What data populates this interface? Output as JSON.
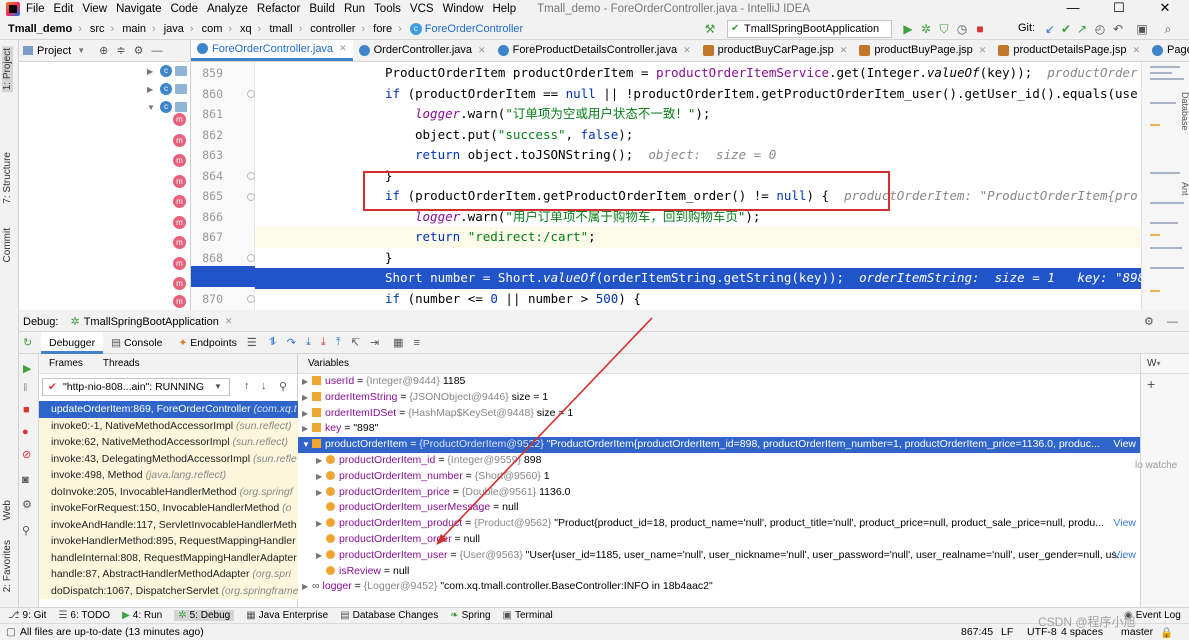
{
  "menu": [
    "File",
    "Edit",
    "View",
    "Navigate",
    "Code",
    "Analyze",
    "Refactor",
    "Build",
    "Run",
    "Tools",
    "VCS",
    "Window",
    "Help"
  ],
  "window_title": "Tmall_demo - ForeOrderController.java - IntelliJ IDEA",
  "breadcrumbs": [
    "Tmall_demo",
    "src",
    "main",
    "java",
    "com",
    "xq",
    "tmall",
    "controller",
    "fore",
    "ForeOrderController"
  ],
  "run_config": "TmallSpringBootApplication",
  "git_label": "Git:",
  "project_panel": {
    "title": "Project"
  },
  "left_strip": [
    "1: Project",
    "7: Structure",
    "Commit",
    "Web",
    "2: Favorites"
  ],
  "right_strip": [
    "Database",
    "Ant"
  ],
  "editor_tabs": [
    {
      "label": "ForeOrderController.java",
      "active": true
    },
    {
      "label": "OrderController.java",
      "active": false
    },
    {
      "label": "ForeProductDetailsController.java",
      "active": false
    },
    {
      "label": "productBuyCarPage.jsp",
      "active": false
    },
    {
      "label": "productBuyPage.jsp",
      "active": false
    },
    {
      "label": "productDetailsPage.jsp",
      "active": false
    },
    {
      "label": "PageUtil",
      "active": false
    }
  ],
  "line_numbers": [
    "859",
    "860",
    "861",
    "862",
    "863",
    "864",
    "865",
    "866",
    "867",
    "868",
    "869",
    "870"
  ],
  "code": {
    "l859a": "ProductOrderItem productOrderItem = ",
    "l859b": "productOrderItemService",
    "l859c": ".get(Integer.",
    "l859d": "valueOf",
    "l859e": "(key));  ",
    "l859h": "productOrder",
    "l860a": "if",
    "l860b": " (productOrderItem == ",
    "l860c": "null",
    "l860d": " || !productOrderItem.getProductOrderItem_user().getUser_id().equals(use",
    "l861a": "logger",
    "l861b": ".warn(",
    "l861c": "\"订单项为空或用户状态不一致！\"",
    "l861d": ");",
    "l862a": "object.put(",
    "l862b": "\"success\"",
    "l862c": ", ",
    "l862d": "false",
    "l862e": ");",
    "l863a": "return",
    "l863b": " object.toJSONString();  ",
    "l863h": "object:  size = 0",
    "l864": "}",
    "l865a": "if",
    "l865b": " (productOrderItem.getProductOrderItem_order() != ",
    "l865c": "null",
    "l865d": ") {  ",
    "l865h": "productOrderItem: \"ProductOrderItem{pro",
    "l866a": "logger",
    "l866b": ".warn(",
    "l866c": "\"用户订单项不属于购物车，回到购物车页\"",
    "l866d": ");",
    "l867a": "return",
    "l867c": "\"redirect:/cart\"",
    "l867d": ";",
    "l868": "}",
    "l869a": "Short number = Short.",
    "l869b": "valueOf",
    "l869c": "(orderItemString.getString(key));  ",
    "l869h": "orderItemString:  size = 1   key: \"898",
    "l870a": "if",
    "l870b": " (number <= ",
    "l870c": "0",
    "l870d": " || number > ",
    "l870e": "500",
    "l870f": ") {"
  },
  "debug": {
    "label": "Debug:",
    "session": "TmallSpringBootApplication",
    "tabs": [
      "Debugger",
      "Console",
      "Endpoints"
    ],
    "frames_tab": "Frames",
    "threads_tab": "Threads",
    "variables_tab": "Variables",
    "thread": "\"http-nio-808...ain\": RUNNING",
    "watches_label": "lo watche",
    "watches_menu": "W",
    "frames": [
      {
        "method": "updateOrderItem:869, ForeOrderController",
        "pkg": "(com.xq.t"
      },
      {
        "method": "invoke0:-1, NativeMethodAccessorImpl",
        "pkg": "(sun.reflect)"
      },
      {
        "method": "invoke:62, NativeMethodAccessorImpl",
        "pkg": "(sun.reflect)"
      },
      {
        "method": "invoke:43, DelegatingMethodAccessorImpl",
        "pkg": "(sun.refle"
      },
      {
        "method": "invoke:498, Method",
        "pkg": "(java.lang.reflect)"
      },
      {
        "method": "doInvoke:205, InvocableHandlerMethod",
        "pkg": "(org.springf"
      },
      {
        "method": "invokeForRequest:150, InvocableHandlerMethod",
        "pkg": "(o"
      },
      {
        "method": "invokeAndHandle:117, ServletInvocableHandlerMeth",
        "pkg": ""
      },
      {
        "method": "invokeHandlerMethod:895, RequestMappingHandler",
        "pkg": ""
      },
      {
        "method": "handleInternal:808, RequestMappingHandlerAdapter",
        "pkg": ""
      },
      {
        "method": "handle:87, AbstractHandlerMethodAdapter",
        "pkg": "(org.spri"
      },
      {
        "method": "doDispatch:1067, DispatcherServlet",
        "pkg": "(org.springframe"
      }
    ],
    "variables": [
      {
        "name": "userId",
        "type": "{Integer@9444}",
        "value": "1185"
      },
      {
        "name": "orderItemString",
        "type": "{JSONObject@9446}",
        "value": " size = 1"
      },
      {
        "name": "orderItemIDSet",
        "type": "{HashMap$KeySet@9448}",
        "value": " size = 1"
      },
      {
        "name": "key",
        "type": "",
        "value": "\"898\""
      },
      {
        "name": "productOrderItem",
        "type": "{ProductOrderItem@9522}",
        "value": "\"ProductOrderItem{productOrderItem_id=898, productOrderItem_number=1, productOrderItem_price=1136.0, produc...",
        "view": "View"
      },
      {
        "name": "productOrderItem_id",
        "type": "{Integer@9559}",
        "value": "898"
      },
      {
        "name": "productOrderItem_number",
        "type": "{Short@9560}",
        "value": "1"
      },
      {
        "name": "productOrderItem_price",
        "type": "{Double@9561}",
        "value": "1136.0"
      },
      {
        "name": "productOrderItem_userMessage",
        "type": "",
        "value": "null"
      },
      {
        "name": "productOrderItem_product",
        "type": "{Product@9562}",
        "value": "\"Product{product_id=18, product_name='null', product_title='null', product_price=null, product_sale_price=null, produ...",
        "view": "View"
      },
      {
        "name": "productOrderItem_order",
        "type": "",
        "value": "null"
      },
      {
        "name": "productOrderItem_user",
        "type": "{User@9563}",
        "value": "\"User{user_id=1185, user_name='null', user_nickname='null', user_password='null', user_realname='null', user_gender=null, us...",
        "view": "View"
      },
      {
        "name": "isReview",
        "type": "",
        "value": "null"
      },
      {
        "name": "logger",
        "type": "{Logger@9452}",
        "value": "\"com.xq.tmall.controller.BaseController:INFO in 18b4aac2\""
      }
    ]
  },
  "bottom_tools": [
    "9: Git",
    "6: TODO",
    "4: Run",
    "5: Debug",
    "Java Enterprise",
    "Database Changes",
    "Spring",
    "Terminal",
    "Event Log"
  ],
  "status": {
    "message": "All files are up-to-date (13 minutes ago)",
    "position": "867:45",
    "line_sep": "LF",
    "encoding": "UTF-8",
    "indent": "4 spaces",
    "branch": "master",
    "watermark": "CSDN @程序小旭"
  },
  "colors": {
    "selection": "#2154c8",
    "annotation": "#d32f2f",
    "accent": "#4083c9"
  }
}
